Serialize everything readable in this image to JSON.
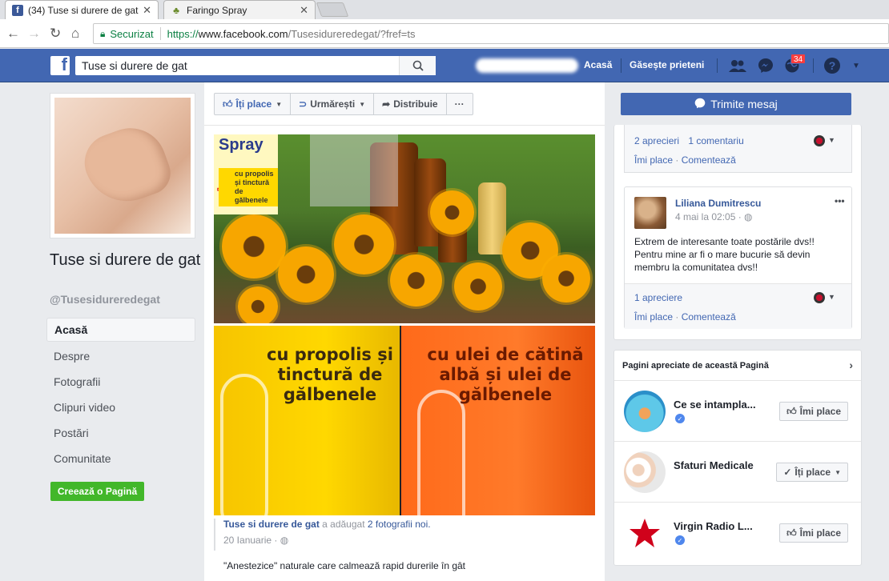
{
  "browser": {
    "tabs": [
      {
        "title": "(34) Tuse si durere de gat",
        "close": "✕"
      },
      {
        "title": "Faringo Spray",
        "close": "✕"
      }
    ],
    "secure_label": "Securizat",
    "url": {
      "scheme": "https://",
      "host": "www.facebook.com",
      "path": "/Tusesidureredegat/?fref=ts"
    }
  },
  "header": {
    "search_value": "Tuse si durere de gat",
    "home_label": "Acasă",
    "find_friends_label": "Găsește prieteni",
    "notifications_count": "34",
    "help_label": "?"
  },
  "left": {
    "page_title": "Tuse si durere de gat",
    "page_handle": "@Tusesidureredegat",
    "nav": [
      "Acasă",
      "Despre",
      "Fotografii",
      "Clipuri video",
      "Postări",
      "Comunitate"
    ],
    "create_page_label": "Creează o Pagină"
  },
  "actions": {
    "like_label": "Îți place",
    "follow_label": "Urmărești",
    "share_label": "Distribuie",
    "more_label": "···"
  },
  "photos": {
    "spray_title": "Spray",
    "spray_sub": "cu propolis și tinctură de gălbenele",
    "box_yellow_text": "cu propolis și tinctură de gălbenele",
    "box_orange_text": "cu ulei de cătină albă și ulei de gălbenele"
  },
  "post": {
    "author": "Tuse si durere de gat",
    "added_text": " a adăugat ",
    "added_link": "2 fotografii noi.",
    "date": "20 Ianuarie · ",
    "globe": "◍",
    "text": "\"Anestezice\" naturale care calmează rapid durerile în gât"
  },
  "right": {
    "message_label": "Trimite mesaj",
    "top_card": {
      "likes": "2 aprecieri",
      "comments": "1 comentariu",
      "like_action": "Îmi place",
      "dot": " · ",
      "comment_action": "Comentează"
    },
    "comment": {
      "author": "Liliana Dumitrescu",
      "date": "4 mai la 02:05 · ◍",
      "text": "Extrem de interesante toate postările dvs!! Pentru mine ar fi o mare bucurie să devin membru la comunitatea dvs!!",
      "likes": "1 apreciere",
      "like_action": "Îmi place",
      "dot": " · ",
      "comment_action": "Comentează",
      "dots": "•••"
    },
    "liked_pages": {
      "title": "Pagini apreciate de această Pagină",
      "items": [
        {
          "name": "Ce se intampla...",
          "button": "Îmi place"
        },
        {
          "name": "Sfaturi Medicale",
          "button": "Îți place"
        },
        {
          "name": "Virgin Radio L...",
          "button": "Îmi place"
        }
      ]
    }
  }
}
